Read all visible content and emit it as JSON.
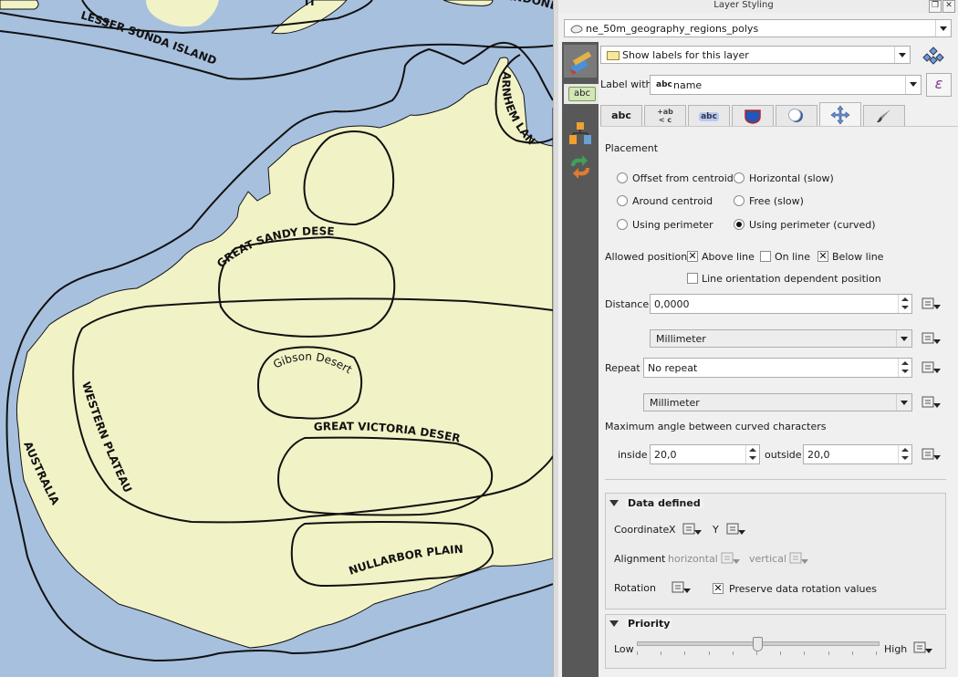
{
  "panel": {
    "title": "Layer Styling",
    "layer_combo": "ne_50m_geography_regions_polys",
    "labels_mode": "Show labels for this layer",
    "label_with": "Label with",
    "label_field": "name",
    "label_field_prefix": "abc",
    "side_abc": "abc",
    "tabs": [
      "abc",
      "+ab\n< c",
      "abc",
      "",
      "",
      "",
      ""
    ],
    "placement": {
      "header": "Placement",
      "options": [
        {
          "label": "Offset from centroid",
          "selected": false
        },
        {
          "label": "Horizontal (slow)",
          "selected": false
        },
        {
          "label": "Around centroid",
          "selected": false
        },
        {
          "label": "Free (slow)",
          "selected": false
        },
        {
          "label": "Using perimeter",
          "selected": false
        },
        {
          "label": "Using perimeter (curved)",
          "selected": true
        }
      ],
      "allowed_positions": "Allowed positions",
      "above_line": "Above line",
      "on_line": "On line",
      "below_line": "Below line",
      "line_orientation": "Line orientation dependent position",
      "distance_label": "Distance",
      "distance_value": "0,0000",
      "distance_unit": "Millimeter",
      "repeat_label": "Repeat",
      "repeat_value": "No repeat",
      "repeat_unit": "Millimeter",
      "max_angle": "Maximum angle between curved characters",
      "inside_label": "inside",
      "inside_value": "20,0",
      "outside_label": "outside",
      "outside_value": "20,0"
    },
    "data_defined": {
      "header": "Data defined",
      "coordinate": "Coordinate",
      "x": "X",
      "y": "Y",
      "alignment": "Alignment",
      "horizontal": "horizontal",
      "vertical": "vertical",
      "rotation": "Rotation",
      "preserve": "Preserve data rotation values"
    },
    "priority": {
      "header": "Priority",
      "low": "Low",
      "high": "High",
      "value": 0.5
    }
  },
  "map": {
    "labels": {
      "lesser_sunda": "LESSER SUNDA ISLANDS",
      "indonesia": "INDONESIA",
      "ti": "TI",
      "arnhem": "ARNHEM LAND",
      "great_sandy": "GREAT SANDY DESERT",
      "gibson": "Gibson Desert",
      "great_victoria": "GREAT VICTORIA DESERT",
      "western_plateau": "WESTERN PLATEAU",
      "australia": "AUSTRALIA",
      "nullarbor": "NULLARBOR PLAIN"
    },
    "colors": {
      "sea": "#a7c0de",
      "land": "#f2f2c7",
      "line": "#111111"
    }
  }
}
